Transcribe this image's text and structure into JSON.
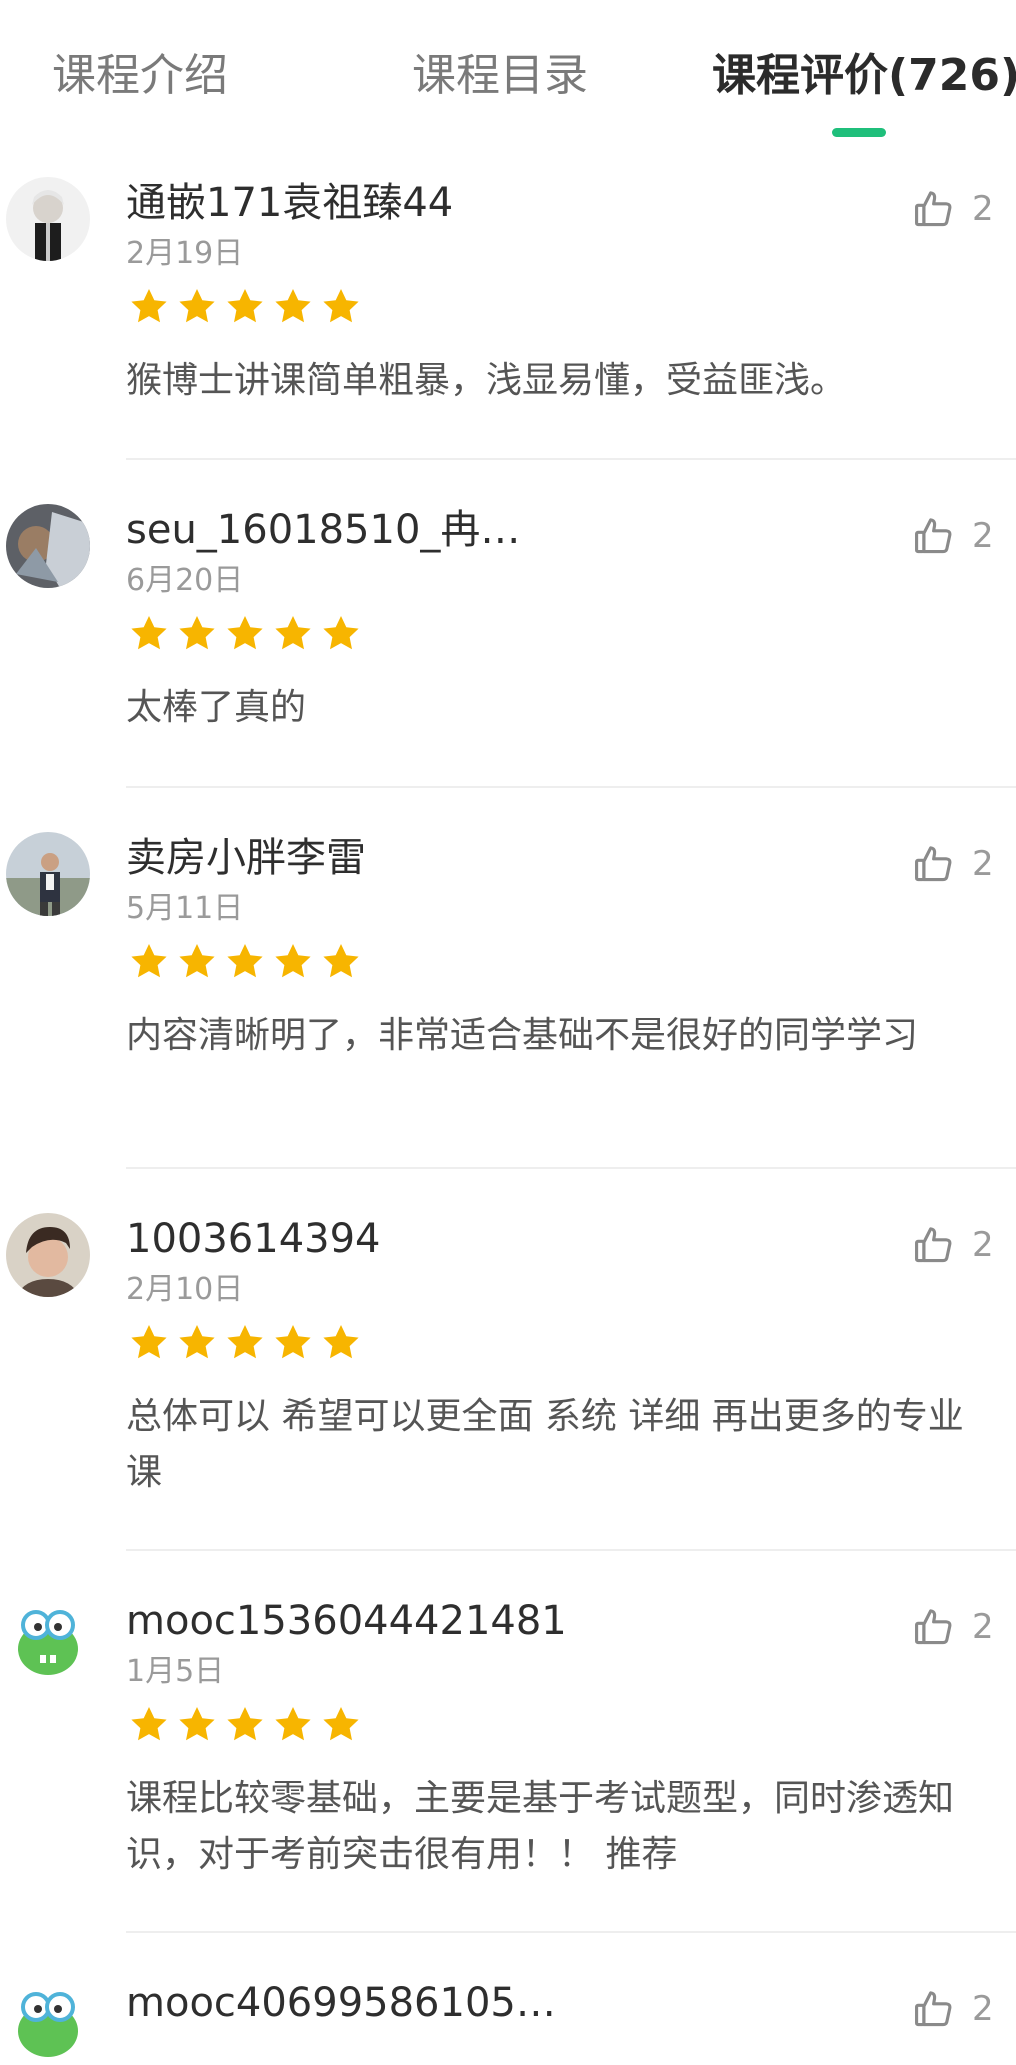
{
  "tabs": [
    {
      "label": "课程介绍",
      "active": false
    },
    {
      "label": "课程目录",
      "active": false
    },
    {
      "label": "课程评价(726)",
      "active": true
    }
  ],
  "colors": {
    "accent": "#1fbf7b",
    "star": "#f7b500",
    "divider": "#eeeeee"
  },
  "icons": {
    "like": "thumbs-up-icon",
    "star": "star-icon"
  },
  "reviews": [
    {
      "username": "通嵌171袁祖臻44",
      "date": "2月19日",
      "stars": 5,
      "likes": "2",
      "content": "猴博士讲课简单粗暴，浅显易懂，受益匪浅。"
    },
    {
      "username": "seu_16018510_冉…",
      "date": "6月20日",
      "stars": 5,
      "likes": "2",
      "content": "太棒了真的"
    },
    {
      "username": "卖房小胖李雷",
      "date": "5月11日",
      "stars": 5,
      "likes": "2",
      "content": "内容清晰明了，非常适合基础不是很好的同学学习"
    },
    {
      "username": "1003614394",
      "date": "2月10日",
      "stars": 5,
      "likes": "2",
      "content": "总体可以  希望可以更全面  系统  详细  再出更多的专业课"
    },
    {
      "username": "mooc1536044421481",
      "date": "1月5日",
      "stars": 5,
      "likes": "2",
      "content": "课程比较零基础，主要是基于考试题型，同时渗透知识，对于考前突击很有用！！ 推荐"
    },
    {
      "username": "mooc40699586105…",
      "date": "",
      "stars": 0,
      "likes": "2",
      "content": ""
    }
  ]
}
